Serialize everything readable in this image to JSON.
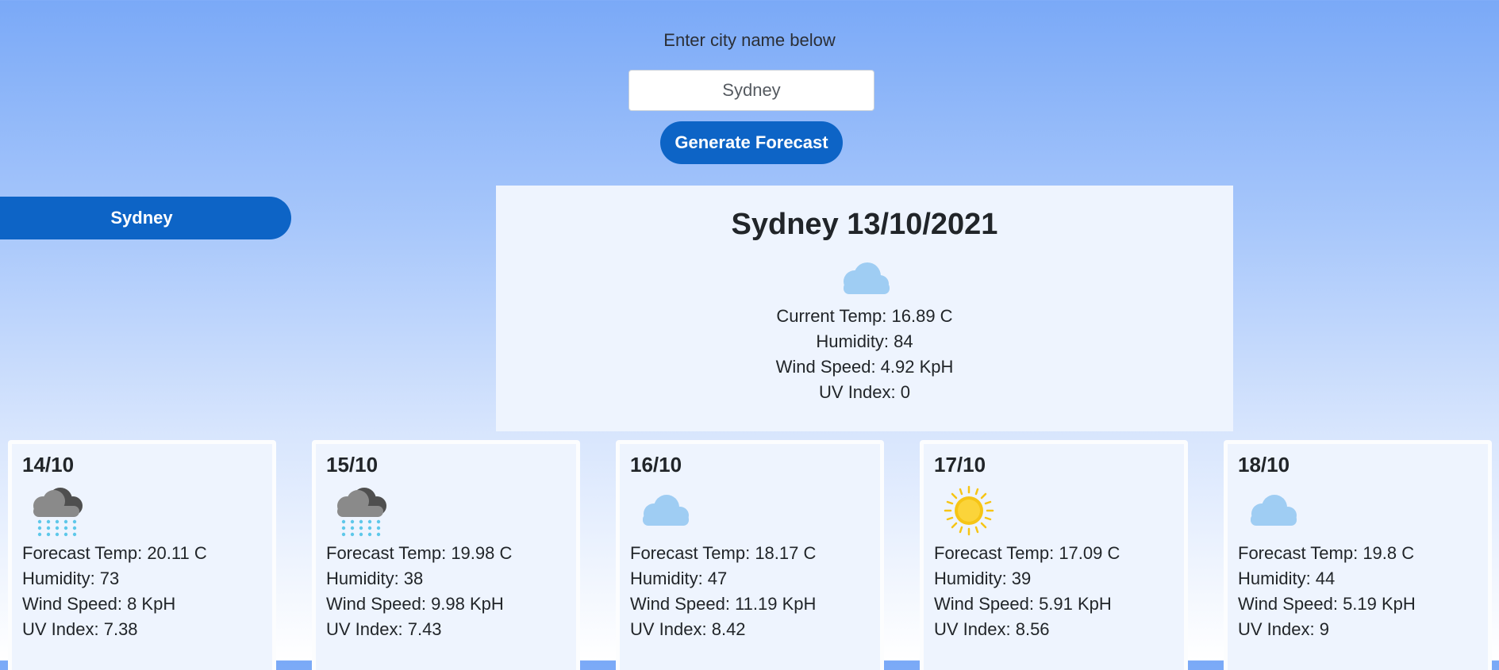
{
  "search": {
    "prompt": "Enter city name below",
    "value": "Sydney",
    "button_label": "Generate Forecast"
  },
  "history": {
    "items": [
      "Sydney"
    ]
  },
  "current": {
    "title": "Sydney 13/10/2021",
    "icon": "cloud-icon",
    "temp": "Current Temp: 16.89 C",
    "humidity": "Humidity: 84",
    "wind": "Wind Speed: 4.92 KpH",
    "uv": "UV Index: 0"
  },
  "forecast": [
    {
      "date": "14/10",
      "icon": "rain-cloud-icon",
      "temp": "Forecast Temp: 20.11 C",
      "humidity": "Humidity: 73",
      "wind": "Wind Speed: 8 KpH",
      "uv": "UV Index: 7.38"
    },
    {
      "date": "15/10",
      "icon": "rain-cloud-icon",
      "temp": "Forecast Temp: 19.98 C",
      "humidity": "Humidity: 38",
      "wind": "Wind Speed: 9.98 KpH",
      "uv": "UV Index: 7.43"
    },
    {
      "date": "16/10",
      "icon": "cloud-icon",
      "temp": "Forecast Temp: 18.17 C",
      "humidity": "Humidity: 47",
      "wind": "Wind Speed: 11.19 KpH",
      "uv": "UV Index: 8.42"
    },
    {
      "date": "17/10",
      "icon": "sun-icon",
      "temp": "Forecast Temp: 17.09 C",
      "humidity": "Humidity: 39",
      "wind": "Wind Speed: 5.91 KpH",
      "uv": "UV Index: 8.56"
    },
    {
      "date": "18/10",
      "icon": "cloud-icon",
      "temp": "Forecast Temp: 19.8 C",
      "humidity": "Humidity: 44",
      "wind": "Wind Speed: 5.19 KpH",
      "uv": "UV Index: 9"
    }
  ],
  "colors": {
    "accent": "#0d64c6",
    "panel": "#eef4fe",
    "cloud": "#9fcdf3",
    "storm_cloud": "#6e6e6e",
    "rain": "#5ec8ea",
    "sun": "#f6c515"
  }
}
